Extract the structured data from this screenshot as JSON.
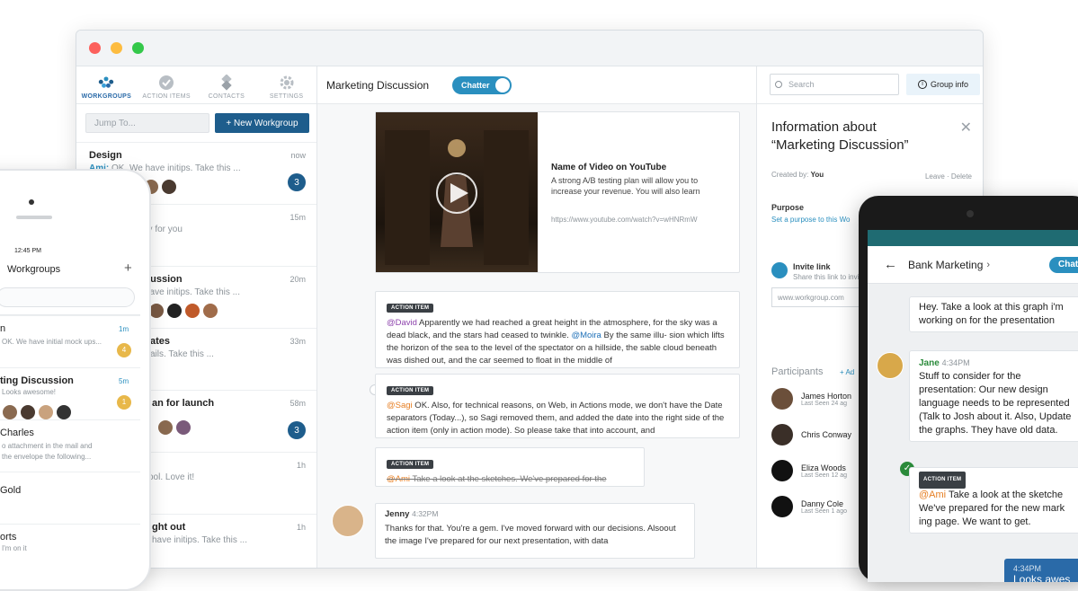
{
  "nav": [
    {
      "label": "WORKGROUPS",
      "icon": "workgroups-icon"
    },
    {
      "label": "ACTION ITEMS",
      "icon": "checkmark-icon"
    },
    {
      "label": "CONTACTS",
      "icon": "contacts-icon"
    },
    {
      "label": "SETTINGS",
      "icon": "gear-icon"
    }
  ],
  "sidebar": {
    "jump_placeholder": "Jump To...",
    "new_workgroup": "+ New Workgroup",
    "workgroups": [
      {
        "name": "Design",
        "time": "now",
        "sender": "Ami:",
        "message": "OK. We have initips. Take this ...",
        "badge": "3"
      },
      {
        "name": "",
        "time": "15m",
        "sender": "",
        "message": "dy for you",
        "badge": ""
      },
      {
        "name": "cussion",
        "time": "20m",
        "sender": "",
        "message": "have initips. Take this ...",
        "badge": ""
      },
      {
        "name": "ates",
        "time": "33m",
        "sender": "",
        "message": "ails. Take this ...",
        "badge": ""
      },
      {
        "name": "an for launch",
        "time": "58m",
        "sender": "",
        "message": "",
        "badge": "3"
      },
      {
        "name": "",
        "time": "1h",
        "sender": "",
        "message": "ool. Love it!",
        "badge": ""
      },
      {
        "name": "ght out",
        "time": "1h",
        "sender": "",
        "message": "have initips. Take this ...",
        "badge": ""
      }
    ]
  },
  "main": {
    "title": "Marketing Discussion",
    "toggle_label": "Chatter",
    "video": {
      "title": "Name of Video on YouTube",
      "desc": "A strong A/B testing plan will allow you to increase your revenue. You will also learn",
      "url": "https://www.youtube.com/watch?v=wHNRmW"
    },
    "action_tag": "ACTION ITEM",
    "ai1": {
      "m1": "@David",
      "t1": " Apparently we had reached a great height in the atmosphere, for the sky was a dead black, and the stars had ceased to twinkle. ",
      "m2": "@Moira",
      "t2": " By the same illu- sion which lifts the horizon of the sea to the level of the spectator on a hillside, the sable cloud beneath was dished out, and the car seemed to float in the middle of"
    },
    "ai2": {
      "m1": "@Sagi",
      "t1": " OK. Also, for technical reasons, on Web, in Actions mode, we don't have the Date separators (Today...), so Sagi removed them, and added the date into the right side of the action item (only in action mode). So please take that into account, and"
    },
    "ai3": {
      "m1": "@Ami",
      "t1": " Take a look at the sketches. We've prepared for the"
    },
    "msg": {
      "name": "Jenny",
      "time": "4:32PM",
      "text": "Thanks for that. You're a gem. I've moved forward with our decisions. Alsoout the image I've prepared for our next presentation, with data"
    }
  },
  "info": {
    "search_placeholder": "Search",
    "group_info": "Group info",
    "title_line1": "Information about",
    "title_line2": "“Marketing Discussion”",
    "created_by_label": "Created by:",
    "created_by": "You",
    "leave_delete": "Leave · Delete",
    "purpose_label": "Purpose",
    "purpose_link": "Set a purpose to this Wo",
    "invite_label": "Invite link",
    "invite_desc": "Share this link to invi",
    "invite_url": "www.workgroup.com",
    "participants_label": "Participants",
    "add_label": "+ Ad",
    "participants": [
      {
        "name": "James Horton",
        "seen": "Last Seen 24 ag"
      },
      {
        "name": "Chris Conway",
        "seen": ""
      },
      {
        "name": "Eliza Woods",
        "seen": "Last Seen 12 ag"
      },
      {
        "name": "Danny Cole",
        "seen": "Last Seen 1 ago"
      }
    ]
  },
  "iphone": {
    "time": "12:45 PM",
    "title": "Workgroups",
    "rows": [
      {
        "name": "n",
        "time": "1m",
        "msg": "OK. We have initial mock ups...",
        "badge": "4"
      },
      {
        "name": "ting Discussion",
        "time": "5m",
        "msg": "Looks awesome!",
        "badge": "1"
      },
      {
        "name": "Charles",
        "time": "",
        "msg": "o attachment in the mail and",
        "msg2": "the envelope the following...",
        "badge": ""
      },
      {
        "name": "Gold",
        "time": "",
        "msg": "",
        "badge": ""
      },
      {
        "name": "orts",
        "time": "",
        "msg": "I'm on it",
        "badge": ""
      }
    ]
  },
  "android": {
    "title": "Bank Marketing",
    "chat_button": "Chat",
    "msg1": "Hey. Take a look at this graph i'm working on for the presentation",
    "jane_name": "Jane",
    "jane_time": "4:34PM",
    "jane_text": "Stuff to consider for the presentation: Our new design language needs to be represented (Talk to Josh about it. Also, Update the graphs. They have old data.",
    "action_tag": "ACTION ITEM",
    "action_mention": "@Ami",
    "action_text": " Take a look at the sketche We've prepared for the new mark ing page. We want to get.",
    "out_time": "4:34PM",
    "out_text": "Looks awes"
  }
}
